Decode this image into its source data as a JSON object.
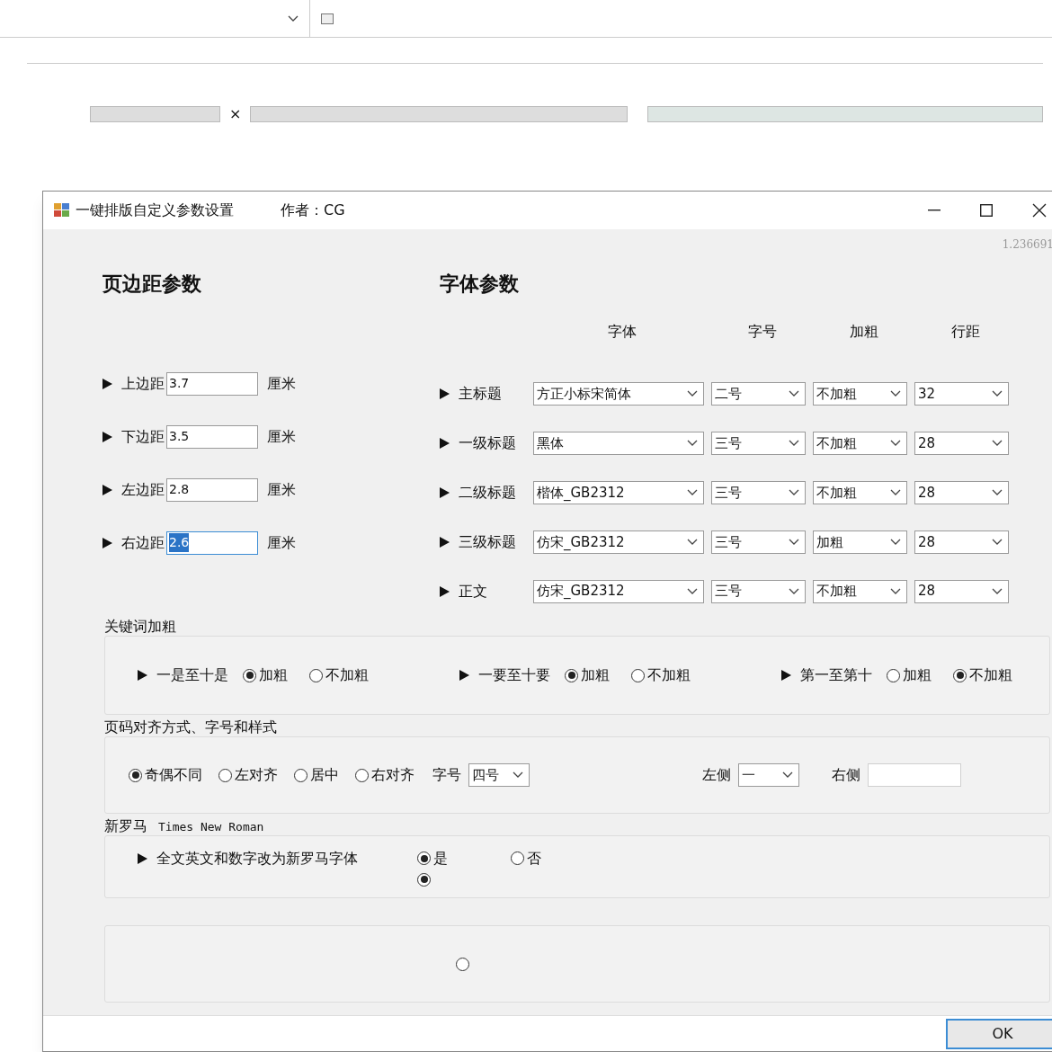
{
  "background": {
    "close_mark": "×"
  },
  "dialog": {
    "title": "一键排版自定义参数设置",
    "author": "作者：CG",
    "version": "1.236691",
    "margins": {
      "heading": "页边距参数",
      "items": [
        {
          "label": "上边距",
          "value": "3.7",
          "unit": "厘米",
          "focused": false
        },
        {
          "label": "下边距",
          "value": "3.5",
          "unit": "厘米",
          "focused": false
        },
        {
          "label": "左边距",
          "value": "2.8",
          "unit": "厘米",
          "focused": false
        },
        {
          "label": "右边距",
          "value": "2.6",
          "unit": "厘米",
          "focused": true
        }
      ]
    },
    "fonts": {
      "heading": "字体参数",
      "columns": [
        "字体",
        "字号",
        "加粗",
        "行距"
      ],
      "rows": [
        {
          "label": "主标题",
          "font": "方正小标宋简体",
          "size": "二号",
          "bold": "不加粗",
          "spacing": "32"
        },
        {
          "label": "一级标题",
          "font": "黑体",
          "size": "三号",
          "bold": "不加粗",
          "spacing": "28"
        },
        {
          "label": "二级标题",
          "font": "楷体_GB2312",
          "size": "三号",
          "bold": "不加粗",
          "spacing": "28"
        },
        {
          "label": "三级标题",
          "font": "仿宋_GB2312",
          "size": "三号",
          "bold": "加粗",
          "spacing": "28"
        },
        {
          "label": "正文",
          "font": "仿宋_GB2312",
          "size": "三号",
          "bold": "不加粗",
          "spacing": "28"
        }
      ]
    },
    "keyword_bold": {
      "title": "关键词加粗",
      "groups": [
        {
          "label": "一是至十是",
          "options": [
            {
              "label": "加粗",
              "selected": true
            },
            {
              "label": "不加粗",
              "selected": false
            }
          ]
        },
        {
          "label": "一要至十要",
          "options": [
            {
              "label": "加粗",
              "selected": true
            },
            {
              "label": "不加粗",
              "selected": false
            }
          ]
        },
        {
          "label": "第一至第十",
          "options": [
            {
              "label": "加粗",
              "selected": false
            },
            {
              "label": "不加粗",
              "selected": true
            }
          ]
        }
      ]
    },
    "page_number": {
      "title": "页码对齐方式、字号和样式",
      "options": [
        {
          "label": "奇偶不同",
          "selected": true
        },
        {
          "label": "左对齐",
          "selected": false
        },
        {
          "label": "居中",
          "selected": false
        },
        {
          "label": "右对齐",
          "selected": false
        }
      ],
      "size_label": "字号",
      "size": "四号",
      "left_label": "左侧",
      "left_value": "一",
      "right_label": "右侧"
    },
    "times": {
      "title": "新罗马",
      "subtitle": "Times New Roman",
      "label": "全文英文和数字改为新罗马字体",
      "options": [
        {
          "label": "是",
          "selected": true
        },
        {
          "label": "否",
          "selected": false
        }
      ],
      "second_selected": true
    },
    "last_group": {
      "radio_selected": false
    },
    "ok": "OK"
  }
}
